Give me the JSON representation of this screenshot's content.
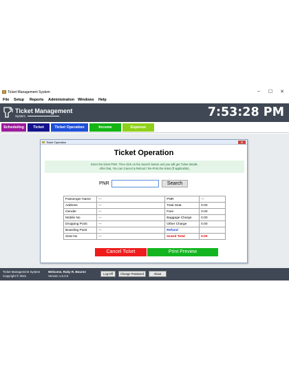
{
  "window": {
    "title": "Ticket Management System",
    "controls": {
      "minimize": "–",
      "maximize": "☐",
      "close": "✕"
    }
  },
  "menu": [
    "File",
    "Setup",
    "Reports",
    "Administration",
    "Windows",
    "Help"
  ],
  "header": {
    "brand": "Ticket Management",
    "brand_sub": "System",
    "clock": "7:53:28 PM"
  },
  "nav": [
    {
      "label": "Scheduling",
      "color": "#9b1b9b"
    },
    {
      "label": "Ticket",
      "color": "#12128c"
    },
    {
      "label": "Ticket Operation",
      "color": "#1f4fd8"
    },
    {
      "label": "Income",
      "color": "#14b414"
    },
    {
      "label": "Expense",
      "color": "#8fd11a"
    }
  ],
  "dialog": {
    "title": "Ticket Operation",
    "close": "✕",
    "heading": "Ticket Operation",
    "info_line1": "Enter the ticket PNR. Then click on the Search button and you will get Ticket details.",
    "info_line2": "After that, You can Cancel & Refund / Re-Print the ticket (If applicable).",
    "pnr_label": "PNR",
    "pnr_value": "",
    "search_label": "Search",
    "rows": [
      {
        "l1": "Passenger Name",
        "v1": "---",
        "l2": "PNR",
        "v2": "---"
      },
      {
        "l1": "Address",
        "v1": "---",
        "l2": "Total Seat",
        "v2": "0.00"
      },
      {
        "l1": "Gender",
        "v1": "---",
        "l2": "Fare",
        "v2": "0.00"
      },
      {
        "l1": "Mobile No",
        "v1": "---",
        "l2": "Baggage Charge",
        "v2": "0.00"
      },
      {
        "l1": "Dropping Point",
        "v1": "---",
        "l2": "Other Charge",
        "v2": "0.00"
      },
      {
        "l1": "Boarding Point",
        "v1": "---",
        "l2": "Refund",
        "v2": ""
      },
      {
        "l1": "Seat No",
        "v1": "---",
        "l2": "Grand Total",
        "v2": "0.00"
      }
    ],
    "cancel_label": "Cancel Ticket",
    "print_label": "Print Preview"
  },
  "status": {
    "app": "Ticket Management System",
    "copyright": "Copyright © 2021",
    "welcome": "Welcome, Ruby R. Bourne",
    "version": "Version 1.6.0.0",
    "logoff": "Log-Off",
    "change_password": "Change Password",
    "about": "About"
  }
}
